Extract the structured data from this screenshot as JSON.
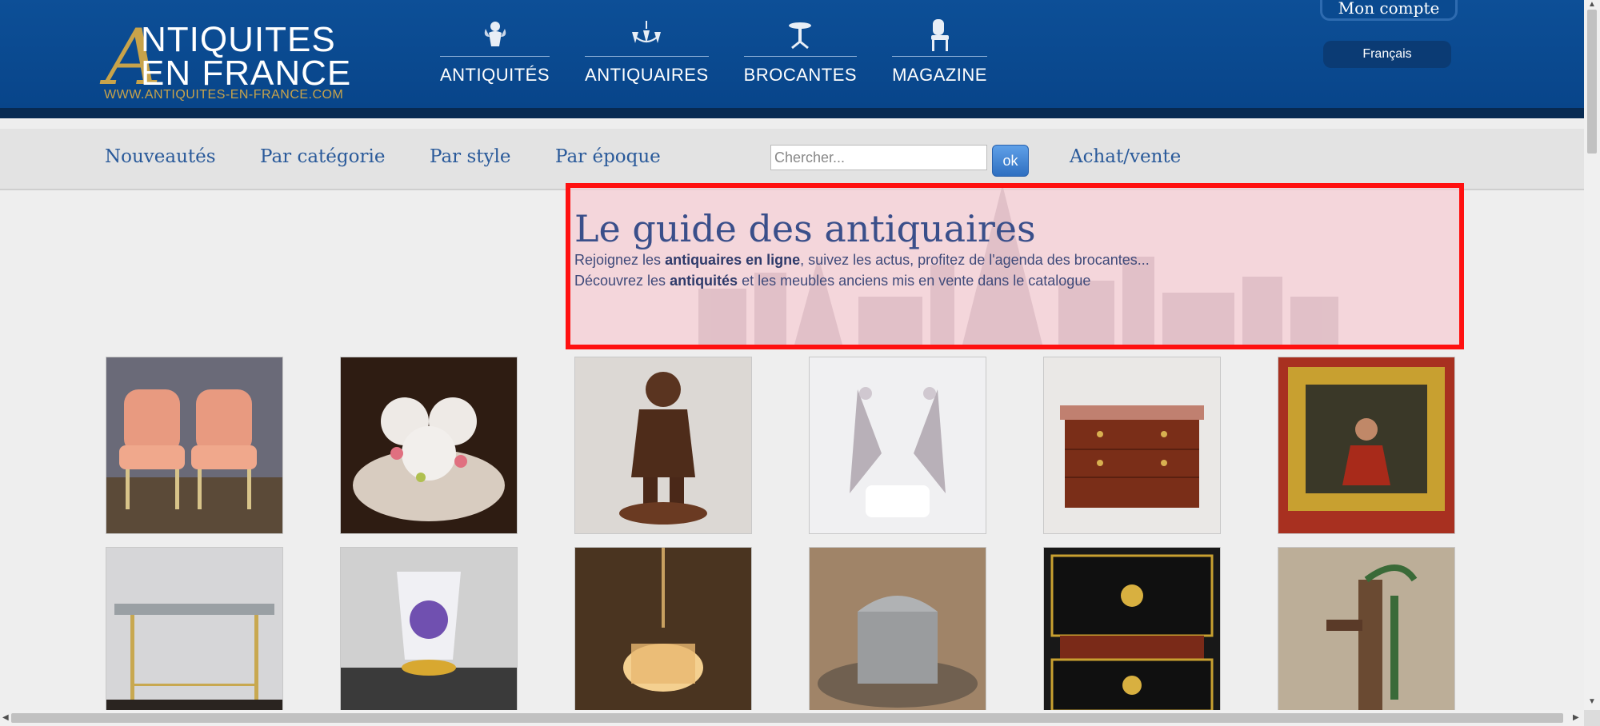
{
  "header": {
    "logo_line1": "NTIQUITES",
    "logo_initial": "A",
    "logo_line2": "EN FRANCE",
    "logo_url": "WWW.ANTIQUITES-EN-FRANCE.COM",
    "nav": [
      {
        "label": "ANTIQUITÉS",
        "icon": "cherub-icon"
      },
      {
        "label": "ANTIQUAIRES",
        "icon": "chandelier-icon"
      },
      {
        "label": "BROCANTES",
        "icon": "pedestal-table-icon"
      },
      {
        "label": "MAGAZINE",
        "icon": "chair-icon"
      }
    ],
    "account": "Mon compte",
    "language": "Français"
  },
  "subnav": {
    "links": [
      "Nouveautés",
      "Par catégorie",
      "Par style",
      "Par époque"
    ],
    "search_placeholder": "Chercher...",
    "ok": "ok",
    "achat": "Achat/vente"
  },
  "guide": {
    "title": "Le guide des antiquaires",
    "line1_a": "Rejoignez les ",
    "line1_b": "antiquaires en ligne",
    "line1_c": ", suivez les actus, profitez de l'agenda des brocantes...",
    "line2_a": "Découvrez les ",
    "line2_b": "antiquités",
    "line2_c": " et les meubles anciens mis en vente dans le catalogue"
  },
  "products": [
    {
      "name": "pair-of-pink-armchairs",
      "bg": "#5a5a66"
    },
    {
      "name": "porcelain-vases",
      "bg": "#2a1a12"
    },
    {
      "name": "bronze-boy-statue",
      "bg": "#d8d4d0"
    },
    {
      "name": "crystal-earrings",
      "bg": "#f2f2f2"
    },
    {
      "name": "marble-top-commode",
      "bg": "#e8e6e4"
    },
    {
      "name": "framed-painting",
      "bg": "#b03020"
    },
    {
      "name": "console-table",
      "bg": "#d0d0d0"
    },
    {
      "name": "painted-glass-pitcher",
      "bg": "#555555"
    },
    {
      "name": "crystal-chandelier",
      "bg": "#3a2818"
    },
    {
      "name": "silver-box",
      "bg": "#7a6048"
    },
    {
      "name": "boulle-cabinet",
      "bg": "#141414"
    },
    {
      "name": "cast-iron-pump",
      "bg": "#b8a890"
    }
  ]
}
